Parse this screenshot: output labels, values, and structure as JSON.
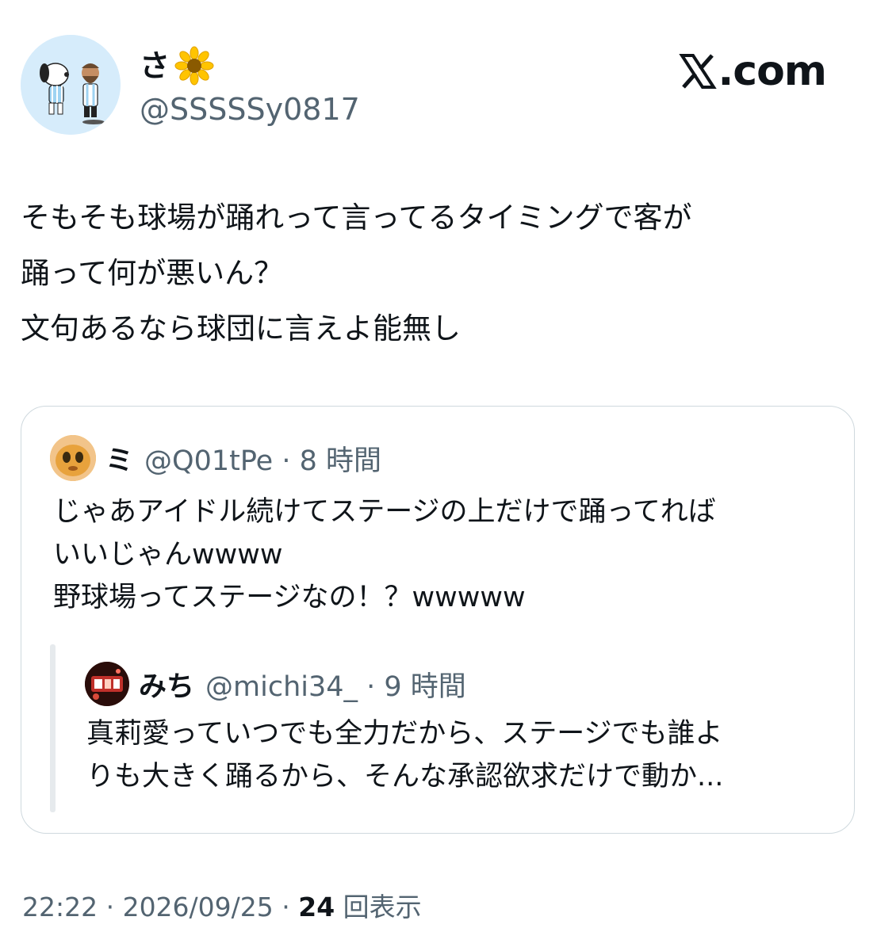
{
  "author": {
    "display_name": "さ",
    "name_emoji": "sunflower-emoji",
    "handle": "@SSSSSy0817",
    "avatar_icon": "profile-avatar-snoopy-messi"
  },
  "brand": {
    "x_icon": "x-logo-icon",
    "label": ".com"
  },
  "tweet": {
    "text": "そもそも球場が踊れって言ってるタイミングで客が\n踊って何が悪いん？\n文句あるなら球団に言えよ能無し"
  },
  "quoted": {
    "display_name": "ミ",
    "handle_time": "@Q01tPe · 8 時間",
    "avatar_icon": "mascot-avatar",
    "text": "じゃあアイドル続けてステージの上だけで踊ってれば\nいいじゃんwwww\n野球場ってステージなの！？wwwww",
    "nested": {
      "display_name": "みち",
      "handle_time": "@michi34_ · 9 時間",
      "avatar_icon": "michi-avatar",
      "text": "真莉愛っていつでも全力だから、ステージでも誰よ\nりも大きく踊るから、そんな承認欲求だけで動か..."
    }
  },
  "footer": {
    "time_date": "22:22 · 2026/09/25 · ",
    "view_count": "24",
    "views_label": " 回表示"
  },
  "colors": {
    "text": "#0f1419",
    "secondary": "#536471",
    "border": "#cfd9de",
    "avatar_bg": "#d6ecfb"
  }
}
